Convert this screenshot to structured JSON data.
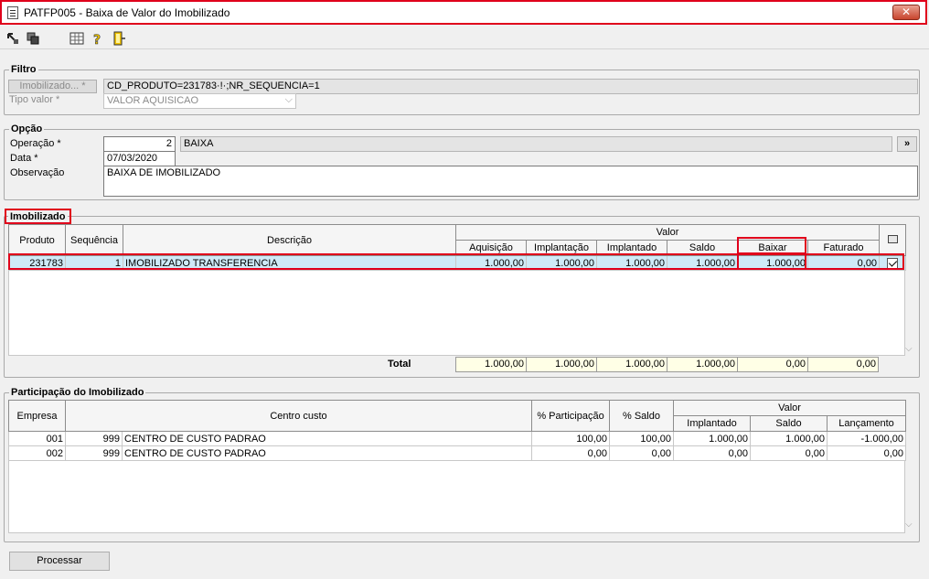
{
  "window": {
    "title": "PATFP005 - Baixa de Valor do Imobilizado",
    "close_label": "✕"
  },
  "toolbar": {
    "icons": [
      "arrow-icon",
      "copy-icon",
      "grid-icon",
      "help-icon",
      "exit-icon"
    ]
  },
  "filtro": {
    "label": "Filtro",
    "imobilizado_button": "Imobilizado... *",
    "imobilizado_value": "CD_PRODUTO=231783·!·;NR_SEQUENCIA=1",
    "tipo_valor_label": "Tipo valor *",
    "tipo_valor_value": "VALOR AQUISICAO"
  },
  "opcao": {
    "label": "Opção",
    "operacao_label": "Operação *",
    "operacao_code": "2",
    "operacao_desc": "BAIXA",
    "more_button": "»",
    "data_label": "Data *",
    "data_value": "07/03/2020",
    "observacao_label": "Observação",
    "observacao_value": "BAIXA DE IMOBILIZADO"
  },
  "imobilizado": {
    "label": "Imobilizado",
    "group_header": "Valor",
    "columns": [
      "Produto",
      "Sequência",
      "Descrição",
      "Aquisição",
      "Implantação",
      "Implantado",
      "Saldo",
      "Baixar",
      "Faturado"
    ],
    "rows": [
      {
        "produto": "231783",
        "sequencia": "1",
        "descricao": "IMOBILIZADO TRANSFERENCIA",
        "aquisicao": "1.000,00",
        "implantacao": "1.000,00",
        "implantado": "1.000,00",
        "saldo": "1.000,00",
        "baixar": "1.000,00",
        "faturado": "0,00",
        "checked": true
      }
    ],
    "total_label": "Total",
    "totals": [
      "1.000,00",
      "1.000,00",
      "1.000,00",
      "1.000,00",
      "0,00",
      "0,00"
    ]
  },
  "participacao": {
    "label": "Participação do Imobilizado",
    "group_header": "Valor",
    "columns": [
      "Empresa",
      "Centro custo",
      "% Participação",
      "% Saldo",
      "Implantado",
      "Saldo",
      "Lançamento"
    ],
    "rows": [
      {
        "empresa": "001",
        "cc_code": "999",
        "cc_desc": "CENTRO DE CUSTO PADRAO",
        "participacao": "100,00",
        "saldo_pct": "100,00",
        "implantado": "1.000,00",
        "saldo": "1.000,00",
        "lancamento": "-1.000,00"
      },
      {
        "empresa": "002",
        "cc_code": "999",
        "cc_desc": "CENTRO DE CUSTO PADRAO",
        "participacao": "0,00",
        "saldo_pct": "0,00",
        "implantado": "0,00",
        "saldo": "0,00",
        "lancamento": "0,00"
      }
    ]
  },
  "processar_button": "Processar",
  "colors": {
    "highlight": "#e0001b",
    "selected_row": "#cfeaf7",
    "totals_bg": "#ffffe6"
  }
}
